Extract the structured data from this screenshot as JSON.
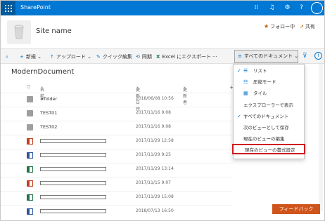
{
  "suite": {
    "brand": "SharePoint"
  },
  "site": {
    "name": "Site name",
    "follow_label": "フォロー中",
    "share_label": "共有"
  },
  "commands": {
    "new_label": "新規",
    "upload_label": "アップロード",
    "quick_edit_label": "クイック編集",
    "sync_label": "同期",
    "export_label": "Excel にエクスポート",
    "more_label": "···",
    "view_label": "すべてのドキュメント"
  },
  "library": {
    "title": "ModernDocument",
    "columns": {
      "name": "名前",
      "modified": "更新日時",
      "modified_by": "更新者",
      "add": "+"
    },
    "rows": [
      {
        "type": "folder",
        "name": "#folder",
        "date": "2018/06/08 10:56"
      },
      {
        "type": "folder",
        "name": "TEST01",
        "date": "2017/11/16 9:08"
      },
      {
        "type": "folder",
        "name": "TEST02",
        "date": "2017/11/16 9:08"
      },
      {
        "type": "doc-r",
        "name": "",
        "date": "2017/11/29 12:58"
      },
      {
        "type": "doc-b",
        "name": "",
        "date": "2017/11/29 9:25"
      },
      {
        "type": "doc-g",
        "name": "",
        "date": "2017/11/29 13:14"
      },
      {
        "type": "doc-r",
        "name": "",
        "date": "2017/11/15 9:07"
      },
      {
        "type": "doc-g",
        "name": "",
        "date": "2017/11/29 15:08"
      },
      {
        "type": "doc-b",
        "name": "",
        "date": "2018/07/13 16:50"
      }
    ]
  },
  "view_menu": {
    "items": [
      {
        "label": "リスト",
        "checked": true,
        "icon": "list-icon"
      },
      {
        "label": "圧縮モード",
        "checked": false,
        "icon": "compact-list-icon"
      },
      {
        "label": "タイル",
        "checked": false,
        "icon": "tiles-icon"
      },
      {
        "label": "エクスプローラーで表示",
        "checked": false,
        "icon": ""
      },
      {
        "label": "すべてのドキュメント",
        "checked": true,
        "icon": ""
      },
      {
        "label": "次のビューとして保存",
        "checked": false,
        "icon": ""
      },
      {
        "label": "現在のビューの編集",
        "checked": false,
        "icon": ""
      },
      {
        "label": "現在のビューの書式設定",
        "checked": false,
        "icon": "",
        "highlighted": true
      }
    ]
  },
  "feedback_label": "フィードバック",
  "colors": {
    "suite": "#0078d4",
    "accent": "#c25a00",
    "highlight_border": "#d0191f",
    "feedback": "#d0551c"
  }
}
